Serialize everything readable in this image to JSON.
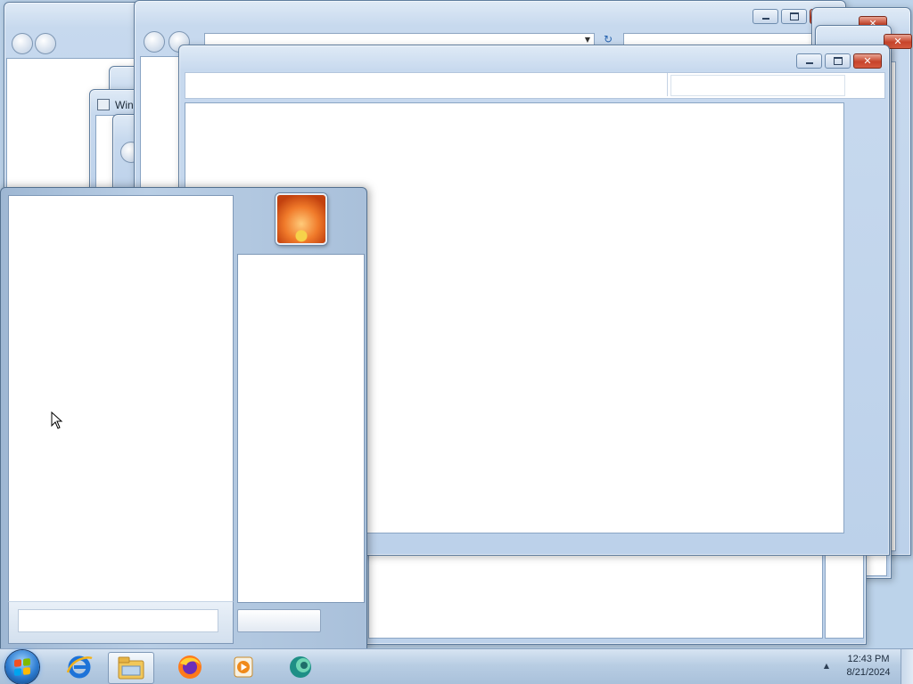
{
  "taskbar": {
    "start_button": "start-orb",
    "pinned": [
      {
        "name": "internet-explorer"
      },
      {
        "name": "file-explorer",
        "active": true
      },
      {
        "name": "firefox"
      },
      {
        "name": "media-player"
      },
      {
        "name": "app"
      }
    ],
    "clock": {
      "time": "12:43 PM",
      "date": "8/21/2024"
    }
  },
  "windows": {
    "back_window_title": "Win"
  },
  "start_menu": {
    "user_picture": "flower"
  },
  "colors": {
    "close_button": "#c7442b",
    "frame": "#bcd1ea",
    "taskbar": "#b8cde3"
  }
}
